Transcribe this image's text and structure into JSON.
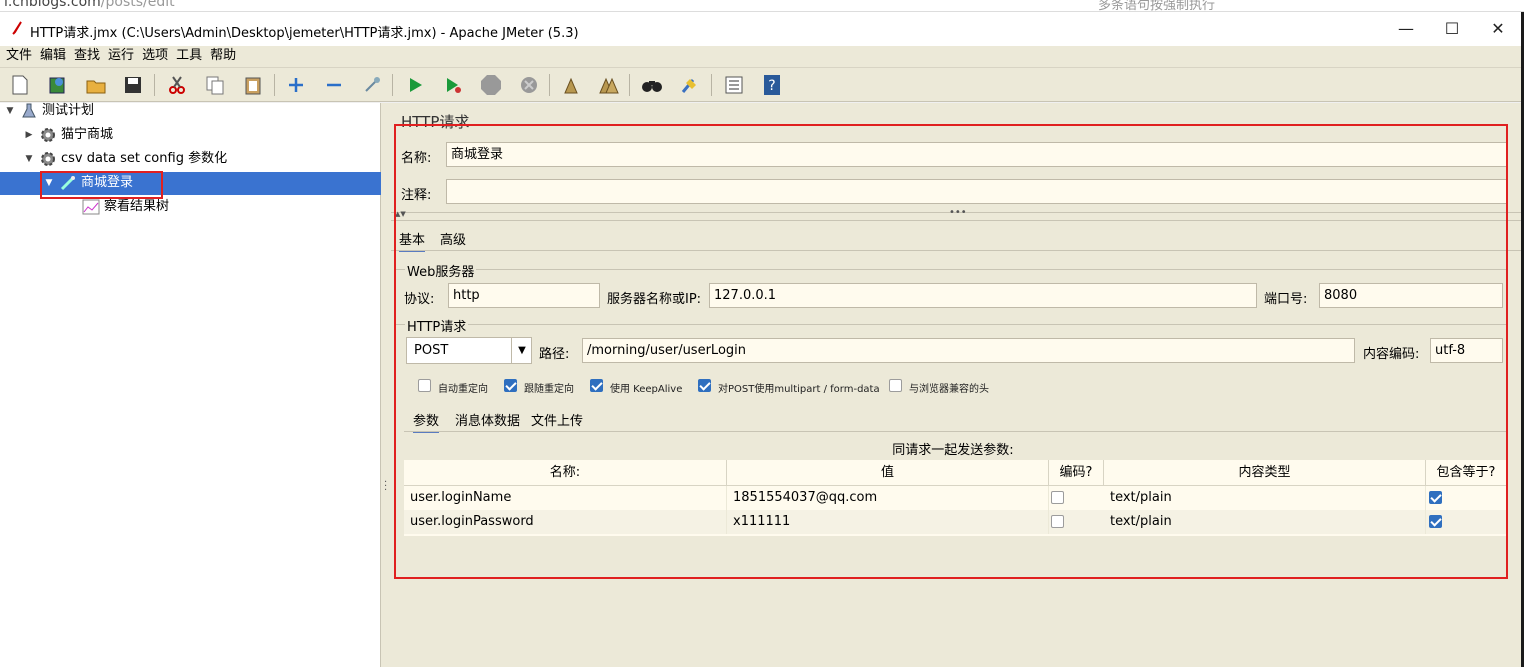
{
  "browser": {
    "url_host": "i.cnblogs.com",
    "url_path": "/posts/edit",
    "search_hint": "多条语句按强制执行"
  },
  "window": {
    "title": "HTTP请求.jmx (C:\\Users\\Admin\\Desktop\\jemeter\\HTTP请求.jmx) - Apache JMeter (5.3)",
    "minimize": "—",
    "maximize": "☐",
    "close": "✕"
  },
  "menu": [
    "文件",
    "编辑",
    "查找",
    "运行",
    "选项",
    "工具",
    "帮助"
  ],
  "tree": {
    "root": "测试计划",
    "items": [
      {
        "label": "猫宁商城"
      },
      {
        "label": "csv data set config 参数化"
      },
      {
        "label": "商城登录"
      },
      {
        "label": "察看结果树"
      }
    ]
  },
  "form": {
    "heading": "HTTP请求",
    "name_label": "名称:",
    "name_value": "商城登录",
    "comment_label": "注释:",
    "comment_value": "",
    "tabs": [
      "基本",
      "高级"
    ],
    "web_server": {
      "title": "Web服务器",
      "protocol_label": "协议:",
      "protocol_value": "http",
      "server_label": "服务器名称或IP:",
      "server_value": "127.0.0.1",
      "port_label": "端口号:",
      "port_value": "8080"
    },
    "http_request": {
      "title": "HTTP请求",
      "method": "POST",
      "path_label": "路径:",
      "path_value": "/morning/user/userLogin",
      "encoding_label": "内容编码:",
      "encoding_value": "utf-8"
    },
    "options": [
      {
        "label": "自动重定向",
        "checked": false
      },
      {
        "label": "跟随重定向",
        "checked": true
      },
      {
        "label": "使用 KeepAlive",
        "checked": true
      },
      {
        "label": "对POST使用multipart / form-data",
        "checked": true
      },
      {
        "label": "与浏览器兼容的头",
        "checked": false
      }
    ],
    "sub_tabs": [
      "参数",
      "消息体数据",
      "文件上传"
    ],
    "params_caption": "同请求一起发送参数:",
    "columns": [
      "名称:",
      "值",
      "编码?",
      "内容类型",
      "包含等于?"
    ],
    "rows": [
      {
        "name": "user.loginName",
        "value": "1851554037@qq.com",
        "encode": false,
        "content_type": "text/plain",
        "include_equals": true
      },
      {
        "name": "user.loginPassword",
        "value": "x111111",
        "encode": false,
        "content_type": "text/plain",
        "include_equals": true
      }
    ]
  },
  "colors": {
    "panel_bg": "#ece9d8",
    "input_bg": "#fffbee",
    "selection": "#3a73d0",
    "highlight_box": "#e02020"
  }
}
